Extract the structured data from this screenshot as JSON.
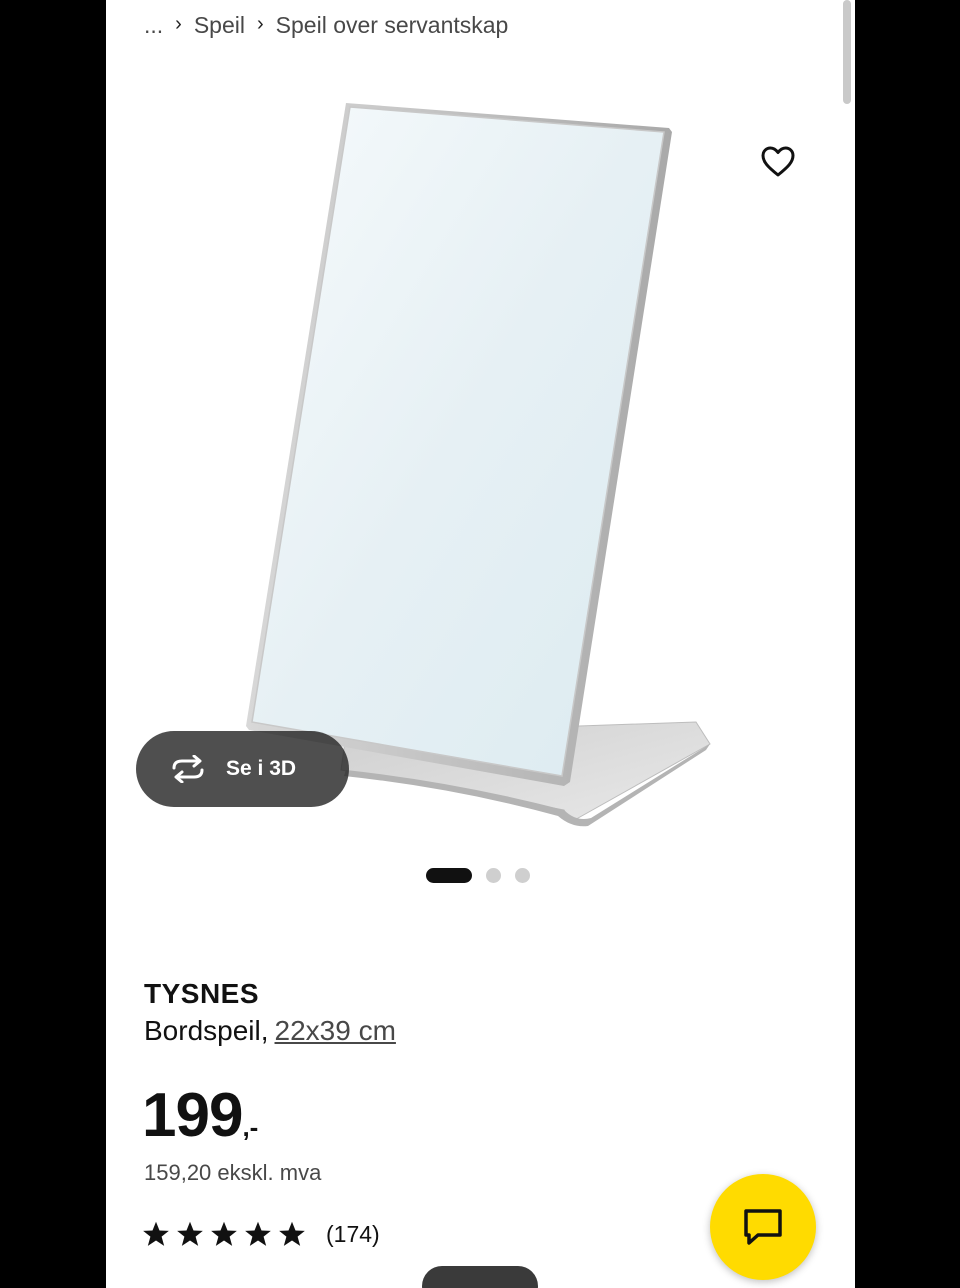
{
  "breadcrumb": {
    "ellipsis": "...",
    "items": [
      "Speil",
      "Speil over servantskap"
    ]
  },
  "gallery": {
    "view_3d_label": "Se i 3D",
    "slide_count": 3,
    "active_slide": 1
  },
  "product": {
    "name": "TYSNES",
    "type": "Bordspeil,",
    "size": "22x39 cm",
    "price": "199",
    "price_suffix": ",-",
    "price_ex_vat": "159,20 ekskl. mva",
    "rating_stars": 5,
    "review_count": "(174)"
  },
  "colors": {
    "chat_button": "#ffdb00",
    "text": "#111111"
  },
  "icons": {
    "favourite": "heart-icon",
    "rotate_3d": "rotate-3d-icon",
    "chat": "chat-icon",
    "breadcrumb_separator": "chevron-right-icon"
  }
}
